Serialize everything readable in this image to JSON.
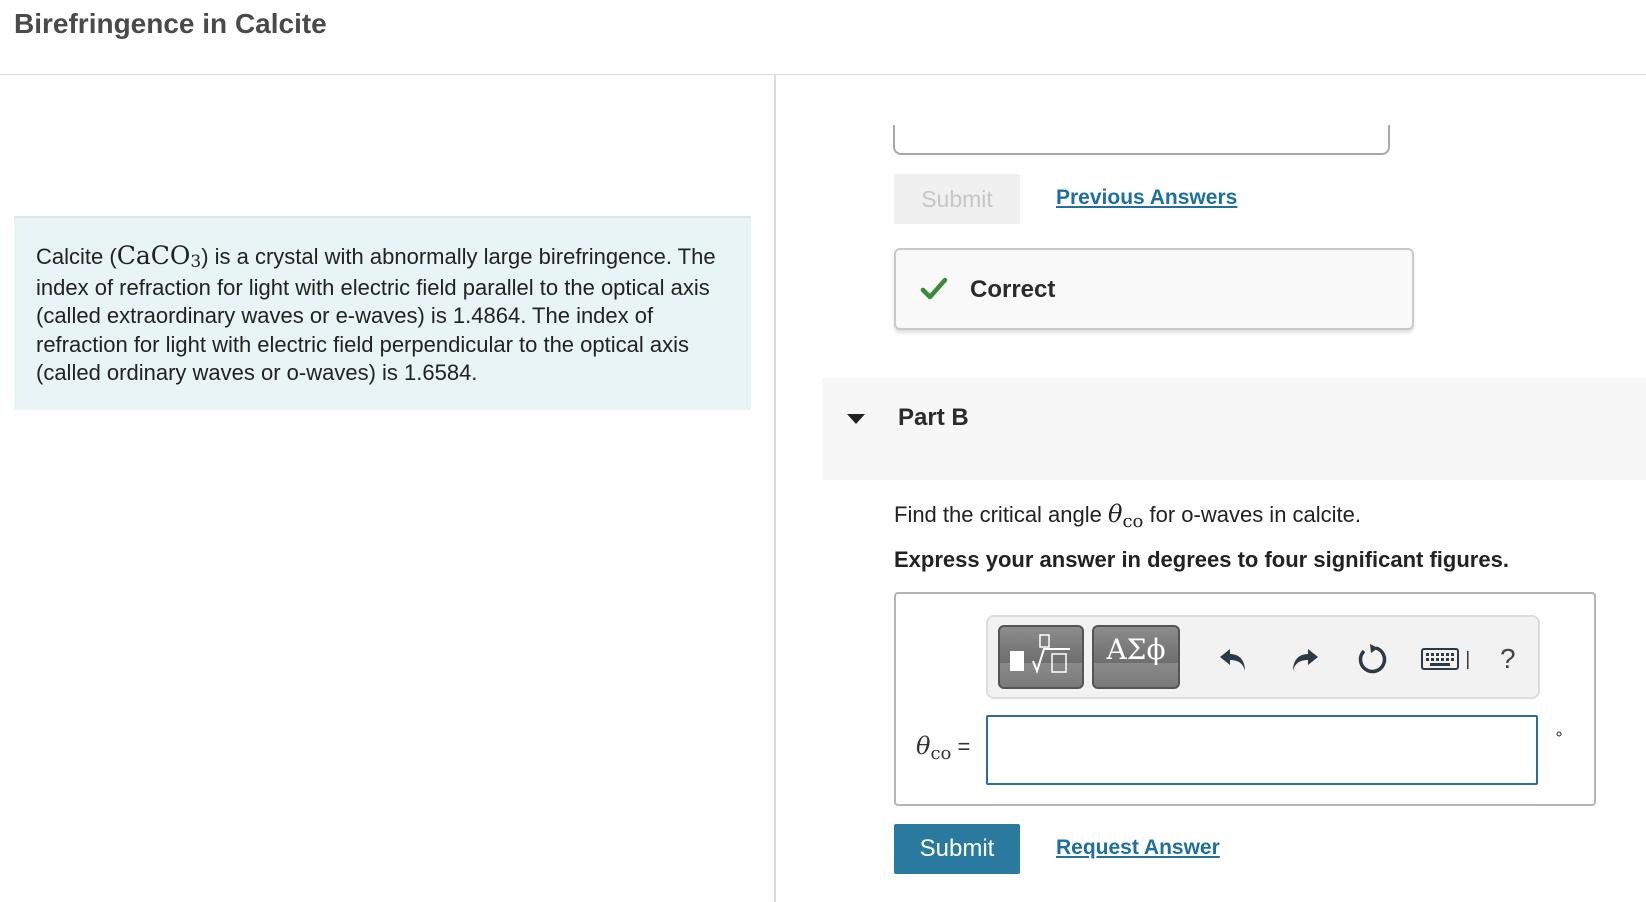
{
  "header": {
    "title": "Birefringence in Calcite"
  },
  "intro": {
    "text_before": "Calcite (",
    "formula_main": "CaCO",
    "formula_sub": "3",
    "text_after": ") is a crystal with abnormally large birefringence. The index of refraction for light with electric field parallel to the optical axis (called extraordinary waves or e-waves) is 1.4864. The index of refraction for light with electric field perpendicular to the optical axis (called ordinary waves or o-waves) is 1.6584."
  },
  "part_a": {
    "submit_label": "Submit",
    "previous_answers_label": "Previous Answers",
    "feedback_label": "Correct"
  },
  "part_b": {
    "title": "Part B",
    "question_before": "Find the critical angle ",
    "theta_symbol": "θ",
    "theta_subscript": "co",
    "question_after": " for o-waves in calcite.",
    "instruction": "Express your answer in degrees to four significant figures.",
    "toolbar": {
      "greek_label": "ΑΣϕ",
      "help_label": "?"
    },
    "variable_equals": "=",
    "answer_value": "",
    "unit": "∘",
    "submit_label": "Submit",
    "request_answer_label": "Request Answer"
  },
  "colors": {
    "accent": "#2a7aa0",
    "link": "#1f6f9f",
    "correct_green": "#3a8a3a",
    "intro_bg": "#e8f4f5"
  },
  "icons": [
    "check-icon",
    "caret-down-icon",
    "templates-icon",
    "undo-icon",
    "redo-icon",
    "reset-icon",
    "keyboard-icon"
  ]
}
